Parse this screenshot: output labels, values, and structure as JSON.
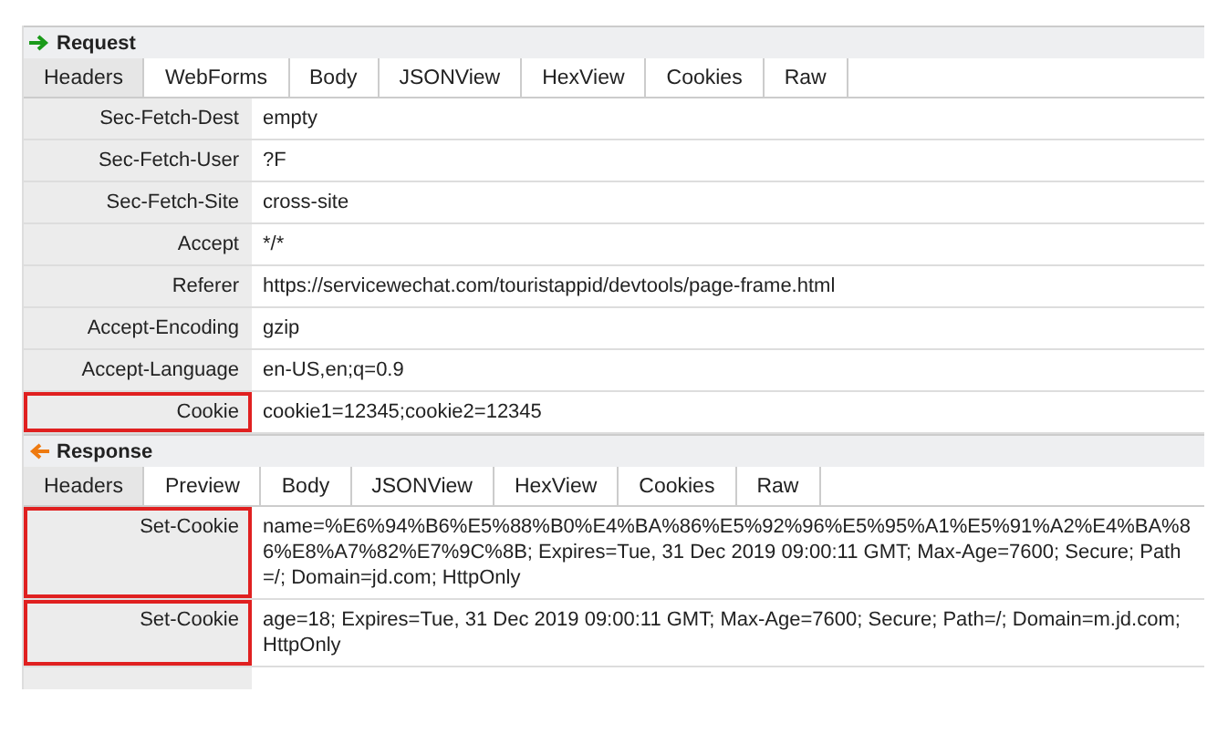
{
  "sections": [
    {
      "kind": "request",
      "title": "Request",
      "tabs": [
        {
          "label": "Headers",
          "selected": true
        },
        {
          "label": "WebForms",
          "selected": false
        },
        {
          "label": "Body",
          "selected": false
        },
        {
          "label": "JSONView",
          "selected": false
        },
        {
          "label": "HexView",
          "selected": false
        },
        {
          "label": "Cookies",
          "selected": false
        },
        {
          "label": "Raw",
          "selected": false
        }
      ],
      "rows": [
        {
          "key": "Sec-Fetch-Dest",
          "value": "empty",
          "highlighted": false
        },
        {
          "key": "Sec-Fetch-User",
          "value": "?F",
          "highlighted": false
        },
        {
          "key": "Sec-Fetch-Site",
          "value": "cross-site",
          "highlighted": false
        },
        {
          "key": "Accept",
          "value": "*/*",
          "highlighted": false
        },
        {
          "key": "Referer",
          "value": "https://servicewechat.com/touristappid/devtools/page-frame.html",
          "highlighted": false
        },
        {
          "key": "Accept-Encoding",
          "value": "gzip",
          "highlighted": false
        },
        {
          "key": "Accept-Language",
          "value": "en-US,en;q=0.9",
          "highlighted": false
        },
        {
          "key": "Cookie",
          "value": "cookie1=12345;cookie2=12345",
          "highlighted": true
        }
      ]
    },
    {
      "kind": "response",
      "title": "Response",
      "tabs": [
        {
          "label": "Headers",
          "selected": true
        },
        {
          "label": "Preview",
          "selected": false
        },
        {
          "label": "Body",
          "selected": false
        },
        {
          "label": "JSONView",
          "selected": false
        },
        {
          "label": "HexView",
          "selected": false
        },
        {
          "label": "Cookies",
          "selected": false
        },
        {
          "label": "Raw",
          "selected": false
        }
      ],
      "rows": [
        {
          "key": "Set-Cookie",
          "value": "name=%E6%94%B6%E5%88%B0%E4%BA%86%E5%92%96%E5%95%A1%E5%91%A2%E4%BA%86%E8%A7%82%E7%9C%8B; Expires=Tue, 31 Dec 2019 09:00:11 GMT; Max-Age=7600; Secure; Path=/; Domain=jd.com; HttpOnly",
          "highlighted": true
        },
        {
          "key": "Set-Cookie",
          "value": "age=18; Expires=Tue, 31 Dec 2019 09:00:11 GMT; Max-Age=7600; Secure; Path=/; Domain=m.jd.com; HttpOnly",
          "highlighted": true
        }
      ]
    }
  ]
}
